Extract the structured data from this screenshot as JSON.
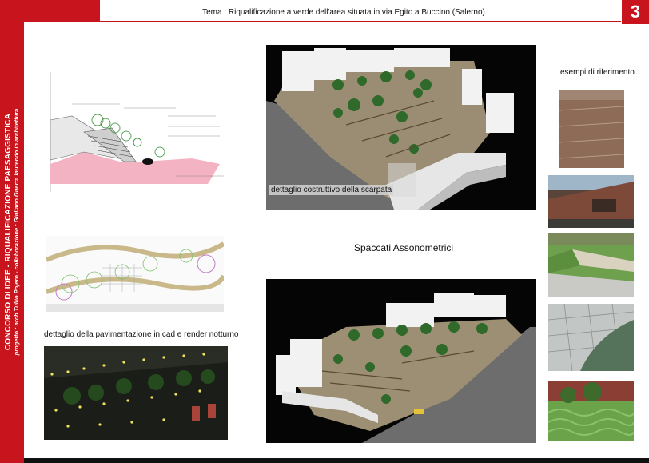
{
  "header": {
    "theme": "Tema : Riqualificazione a verde dell'area situata in via Egito a Buccino (Salerno)",
    "page_number": "3"
  },
  "sidebar": {
    "title": "CONCORSO DI IDEE - RIQUALIFICAZIONE PAESAGGISTICA",
    "credits": "progetto : arch.Tullio Pojero - collaborazione : Giuliano Guerra laurendo in architettura"
  },
  "captions": {
    "scarpata": "dettaglio costruttivo della scarpata",
    "spaccati": "Spaccati Assonometrici",
    "pavimentazione": "dettaglio della pavimentazione in cad e render notturno",
    "esempi": "esempi di riferimento"
  },
  "colors": {
    "brand_red": "#c8141c",
    "render_black": "#050505",
    "ground_grey": "#6d6d6d"
  }
}
